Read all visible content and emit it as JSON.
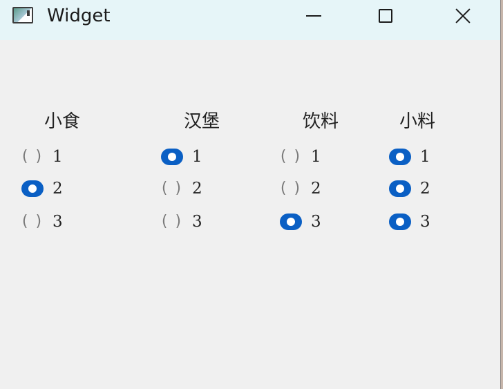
{
  "window": {
    "title": "Widget",
    "icon": "app-window-icon",
    "buttons": {
      "minimize": "minimize-icon",
      "maximize": "maximize-icon",
      "close": "close-icon"
    }
  },
  "accent_color": "#0a5fc4",
  "groups": [
    {
      "title": "小食",
      "options": [
        {
          "label": "1",
          "checked": false
        },
        {
          "label": "2",
          "checked": true
        },
        {
          "label": "3",
          "checked": false
        }
      ]
    },
    {
      "title": "汉堡",
      "options": [
        {
          "label": "1",
          "checked": true
        },
        {
          "label": "2",
          "checked": false
        },
        {
          "label": "3",
          "checked": false
        }
      ]
    },
    {
      "title": "饮料",
      "options": [
        {
          "label": "1",
          "checked": false
        },
        {
          "label": "2",
          "checked": false
        },
        {
          "label": "3",
          "checked": true
        }
      ]
    },
    {
      "title": "小料",
      "options": [
        {
          "label": "1",
          "checked": true
        },
        {
          "label": "2",
          "checked": true
        },
        {
          "label": "3",
          "checked": true
        }
      ]
    }
  ]
}
